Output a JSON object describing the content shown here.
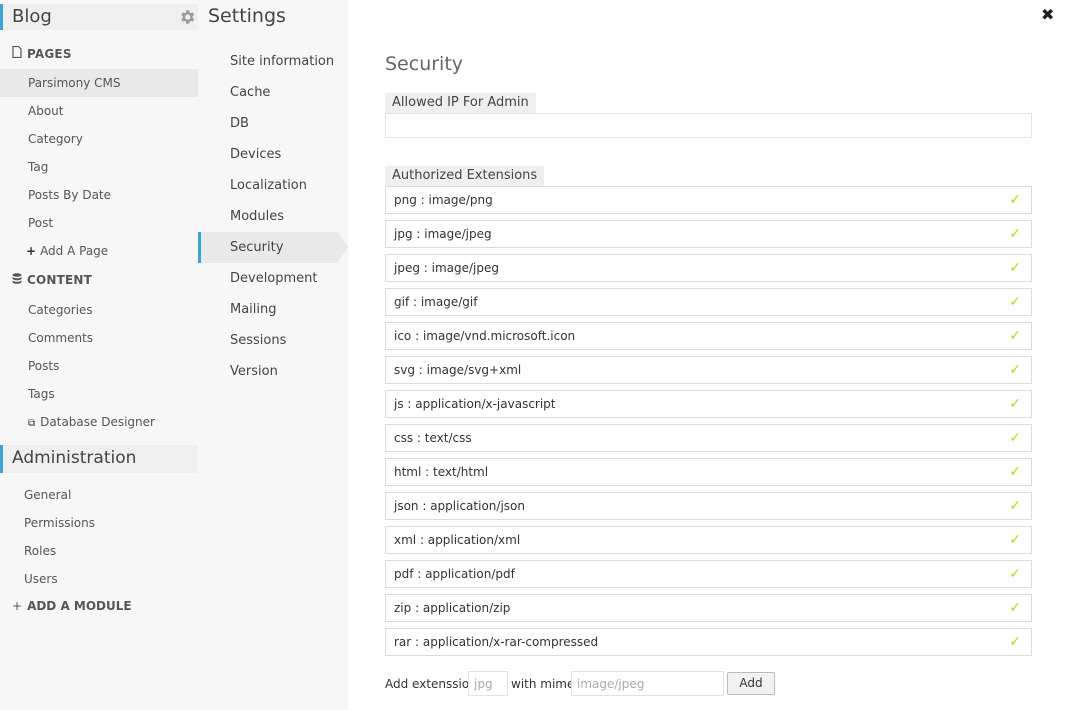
{
  "sidebar": {
    "blog_title": "Blog",
    "pages_title": "PAGES",
    "pages": [
      {
        "label": "Parsimony CMS"
      },
      {
        "label": "About"
      },
      {
        "label": "Category"
      },
      {
        "label": "Tag"
      },
      {
        "label": "Posts By Date"
      },
      {
        "label": "Post"
      }
    ],
    "add_page": "Add A Page",
    "content_title": "CONTENT",
    "content": [
      {
        "label": "Categories"
      },
      {
        "label": "Comments"
      },
      {
        "label": "Posts"
      },
      {
        "label": "Tags"
      }
    ],
    "database_designer": "Database Designer",
    "admin_title": "Administration",
    "admin": [
      {
        "label": "General"
      },
      {
        "label": "Permissions"
      },
      {
        "label": "Roles"
      },
      {
        "label": "Users"
      }
    ],
    "add_module": "ADD A MODULE"
  },
  "settings": {
    "title": "Settings",
    "items": [
      {
        "label": "Site information"
      },
      {
        "label": "Cache"
      },
      {
        "label": "DB"
      },
      {
        "label": "Devices"
      },
      {
        "label": "Localization"
      },
      {
        "label": "Modules"
      },
      {
        "label": "Security"
      },
      {
        "label": "Development"
      },
      {
        "label": "Mailing"
      },
      {
        "label": "Sessions"
      },
      {
        "label": "Version"
      }
    ],
    "active_index": 6
  },
  "panel": {
    "title": "Security",
    "allowed_ip_label": "Allowed IP For Admin",
    "allowed_ip_value": "",
    "extensions_label": "Authorized Extensions",
    "extensions": [
      {
        "label": "png : image/png"
      },
      {
        "label": "jpg : image/jpeg"
      },
      {
        "label": "jpeg : image/jpeg"
      },
      {
        "label": "gif : image/gif"
      },
      {
        "label": "ico : image/vnd.microsoft.icon"
      },
      {
        "label": "svg : image/svg+xml"
      },
      {
        "label": "js : application/x-javascript"
      },
      {
        "label": "css : text/css"
      },
      {
        "label": "html : text/html"
      },
      {
        "label": "json : application/json"
      },
      {
        "label": "xml : application/xml"
      },
      {
        "label": "pdf : application/pdf"
      },
      {
        "label": "zip : application/zip"
      },
      {
        "label": "rar : application/x-rar-compressed"
      }
    ],
    "add_extension_label": "Add extenssion",
    "ext_placeholder": "jpg",
    "with_mime_label": "with mime",
    "mime_placeholder": "image/jpeg",
    "add_button": "Add"
  },
  "icons": {
    "check": "✓",
    "close": "✖",
    "plus": "+",
    "external": "⧉"
  },
  "colors": {
    "accent": "#39a6d6",
    "check": "#b5d41a"
  }
}
